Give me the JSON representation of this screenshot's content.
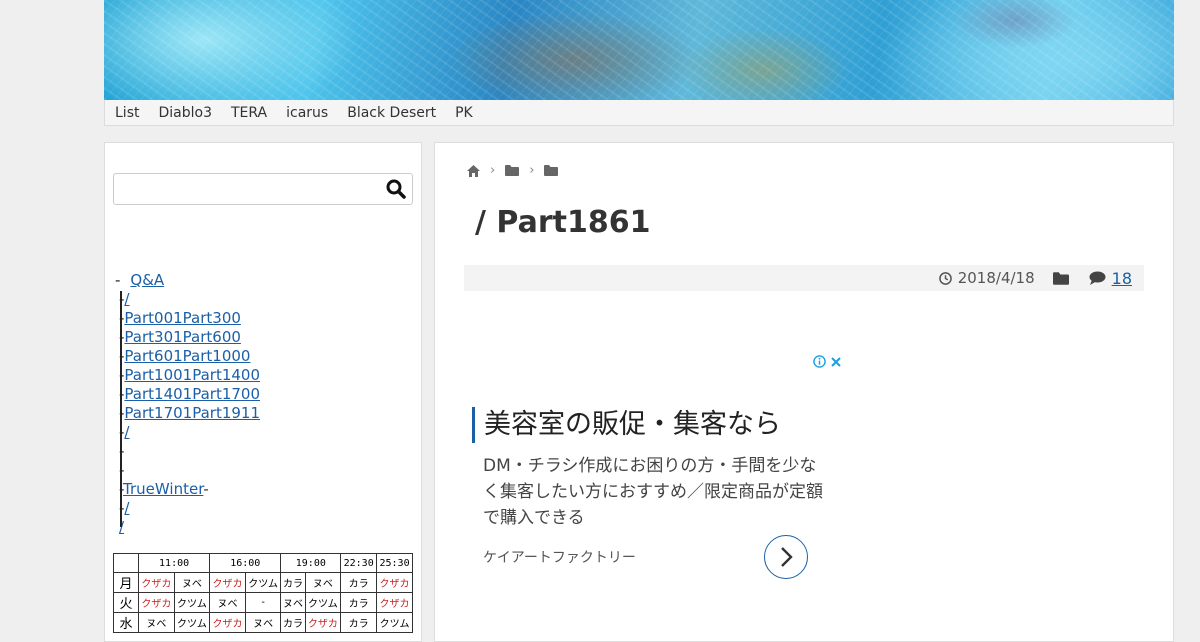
{
  "nav": {
    "items": [
      "List",
      "Diablo3",
      "TERA",
      "icarus",
      "Black Desert",
      "PK"
    ]
  },
  "search": {
    "value": "",
    "placeholder": ""
  },
  "tree": {
    "rows": [
      {
        "prefix": "-",
        "label": "Q&A"
      },
      {
        "prefix": "-",
        "label": "/"
      },
      {
        "prefix": "-",
        "label": "Part001Part300"
      },
      {
        "prefix": "-",
        "label": "Part301Part600"
      },
      {
        "prefix": "-",
        "label": "Part601Part1000"
      },
      {
        "prefix": "-",
        "label": "Part1001Part1400"
      },
      {
        "prefix": "-",
        "label": "Part1401Part1700"
      },
      {
        "prefix": "-",
        "label": "Part1701Part1911"
      },
      {
        "prefix": "-",
        "label": "/"
      },
      {
        "prefix": "-",
        "label": ""
      },
      {
        "prefix": "-",
        "label": ""
      },
      {
        "prefix": "-",
        "label": "TrueWinter",
        "suffix": "-"
      },
      {
        "prefix": "-",
        "label": "/"
      },
      {
        "prefix": "",
        "label": "/"
      }
    ]
  },
  "schedule": {
    "times": [
      "11:00",
      "16:00",
      "19:00",
      "22:30",
      "25:30"
    ],
    "rows": [
      {
        "day": "月",
        "cells": [
          [
            "クザカ",
            "red"
          ],
          [
            "ヌベ",
            ""
          ],
          [
            "クザカ",
            "red"
          ],
          [
            "クツム",
            ""
          ],
          [
            "カラ",
            ""
          ],
          [
            "ヌベ",
            ""
          ],
          [
            "カラ",
            ""
          ],
          [
            "クザカ",
            "red"
          ]
        ]
      },
      {
        "day": "火",
        "cells": [
          [
            "クザカ",
            "red"
          ],
          [
            "クツム",
            ""
          ],
          [
            "ヌベ",
            ""
          ],
          [
            "-",
            ""
          ],
          [
            "ヌベ",
            ""
          ],
          [
            "クツム",
            ""
          ],
          [
            "カラ",
            ""
          ],
          [
            "クザカ",
            "red"
          ]
        ]
      },
      {
        "day": "水",
        "cells": [
          [
            "ヌベ",
            ""
          ],
          [
            "クツム",
            ""
          ],
          [
            "クザカ",
            "red"
          ],
          [
            "ヌベ",
            ""
          ],
          [
            "カラ",
            ""
          ],
          [
            "クザカ",
            "red"
          ],
          [
            "カラ",
            ""
          ],
          [
            "クツム",
            ""
          ]
        ]
      }
    ]
  },
  "article": {
    "title": " / Part1861",
    "date": "2018/4/18",
    "comments": "18"
  },
  "ad": {
    "headline": "美容室の販促・集客なら",
    "body": "DM・チラシ作成にお困りの方・手間を少なく集客したい方におすすめ／限定商品が定額で購入できる",
    "advertiser": "ケイアートファクトリー"
  },
  "colors": {
    "link": "#1a5fa8",
    "red": "#c22222",
    "meta_bg": "#f3f3f3"
  }
}
